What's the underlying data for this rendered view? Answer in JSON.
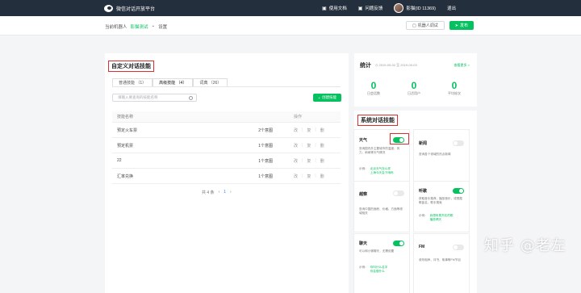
{
  "topbar": {
    "brand": "微信对话开放平台",
    "doc": "使用文档",
    "feedback": "问题反馈",
    "user": "影猫(ID 11369)",
    "logout": "退出"
  },
  "subbar": {
    "crumb_prefix": "当前机器人",
    "crumb_bot": "影猫测试",
    "crumb_page": "设置",
    "test_button": "机器人调试",
    "publish_button": "发布"
  },
  "custom": {
    "title": "自定义对话技能",
    "tabs": [
      "普通技能 （1）",
      "高级技能 （4）",
      "词典 （26）"
    ],
    "search_placeholder": "请输入要查询的技能名称",
    "create_button": "创建技能",
    "headers": {
      "name": "技能名称",
      "ops": "操作"
    },
    "rows": [
      {
        "name": "预定火车票",
        "meta": "2个意图",
        "edit": "改",
        "copy": "复",
        "delete": "删"
      },
      {
        "name": "预定机票",
        "meta": "1个意图",
        "edit": "改",
        "copy": "复",
        "delete": "删"
      },
      {
        "name": "22",
        "meta": "1个意图",
        "edit": "改",
        "copy": "复",
        "delete": "删"
      },
      {
        "name": "汇率兑换",
        "meta": "1个意图",
        "edit": "改",
        "copy": "复",
        "delete": "删"
      }
    ],
    "pager": {
      "total": "共 4 条",
      "prev": "‹",
      "page": "1",
      "next": "›"
    }
  },
  "stats": {
    "title": "统计",
    "date": "2019-09-02 至 2019-09-03",
    "more": "查看更多 >",
    "items": [
      {
        "value": "0",
        "label": "日会话数"
      },
      {
        "value": "0",
        "label": "日活用户"
      },
      {
        "value": "0",
        "label": "平均轮次"
      }
    ]
  },
  "system": {
    "title": "系统对话技能",
    "skills": [
      {
        "title": "天气",
        "desc": "查询国内外主要城市的温度、风力、雨雨等天气情况",
        "example_label": "示例：",
        "examples": [
          "北京天气怎么样",
          "上海今天会下雨吗"
        ],
        "enabled": true
      },
      {
        "title": "新闻",
        "desc": "查询各个领域的热点新闻",
        "example_label": "",
        "examples": [],
        "enabled": false
      },
      {
        "title": "越察",
        "desc": "查询中国的面积、价格、方面等领域相关",
        "example_label": "",
        "examples": [],
        "enabled": false
      },
      {
        "title": "听歌",
        "desc": "获取音乐推荐，播放音乐，或根据歌曲名、歌手搜索",
        "example_label": "示例：",
        "examples": [
          "我想听周杰伦的歌",
          "播放晴天"
        ],
        "enabled": true
      },
      {
        "title": "聊天",
        "desc": "可以和小微聊天，无需设置",
        "example_label": "示例：",
        "examples": [
          "你叫什么名字",
          "你会做什么"
        ],
        "enabled": true
      },
      {
        "title": "FM",
        "desc": "收听相声、评书、故事等FM节目",
        "example_label": "",
        "examples": [],
        "enabled": false
      }
    ]
  },
  "watermark": "知乎 @老左",
  "colors": {
    "accent": "#07c160",
    "topbar": "#242f3d",
    "highlight": "#df2c2c"
  }
}
